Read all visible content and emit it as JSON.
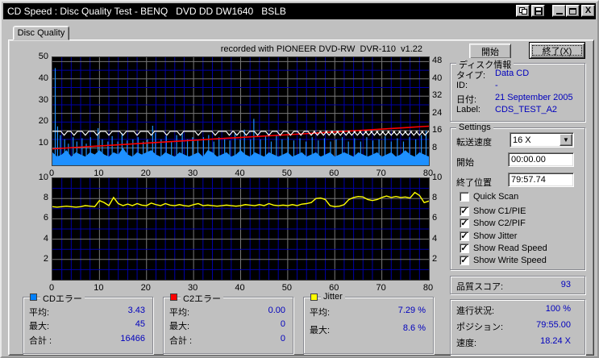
{
  "window": {
    "title": "CD Speed : Disc Quality Test - BENQ   DVD DD DW1640   BSLB",
    "titlebar_buttons": [
      "copy",
      "save",
      "minimize",
      "maximize",
      "close"
    ],
    "close_glyph": "X"
  },
  "tab": {
    "label": "Disc Quality"
  },
  "chart_header": "recorded with PIONEER DVD-RW  DVR-110  v1.22",
  "sidebar": {
    "start_button": "開始",
    "exit_button": "終了(X)",
    "disc_info": {
      "title": "ディスク情報",
      "rows": [
        {
          "label": "タイプ:",
          "value": "Data CD"
        },
        {
          "label": "ID:",
          "value": "-"
        },
        {
          "label": "日付:",
          "value": "21 September 2005"
        },
        {
          "label": "Label:",
          "value": "CDS_TEST_A2"
        }
      ]
    },
    "settings": {
      "title": "Settings",
      "speed_label": "転送速度",
      "speed_value": "16 X",
      "start_label": "開始",
      "start_value": "00:00.00",
      "end_label": "終了位置",
      "end_value": "79:57.74",
      "checkboxes": [
        {
          "label": "Quick Scan",
          "checked": false
        },
        {
          "label": "Show C1/PIE",
          "checked": true
        },
        {
          "label": "Show C2/PIF",
          "checked": true
        },
        {
          "label": "Show Jitter",
          "checked": true
        },
        {
          "label": "Show Read Speed",
          "checked": true
        },
        {
          "label": "Show Write Speed",
          "checked": true
        }
      ]
    },
    "score": {
      "label": "品質スコア:",
      "value": "93"
    },
    "progress": {
      "rows": [
        {
          "label": "進行状況:",
          "value": "100 %"
        },
        {
          "label": "ポジション:",
          "value": "79:55.00"
        },
        {
          "label": "速度:",
          "value": "18.24 X"
        }
      ]
    }
  },
  "stats": [
    {
      "title": "CDエラー",
      "color": "#0080ff",
      "rows": [
        {
          "label": "平均:",
          "value": "3.43"
        },
        {
          "label": "最大:",
          "value": "45"
        },
        {
          "label": "合計 :",
          "value": "16466"
        }
      ]
    },
    {
      "title": "C2エラー",
      "color": "#ff0000",
      "rows": [
        {
          "label": "平均:",
          "value": "0.00"
        },
        {
          "label": "最大:",
          "value": "0"
        },
        {
          "label": "合計 :",
          "value": "0"
        }
      ]
    },
    {
      "title": "Jitter",
      "color": "#ffff00",
      "rows": [
        {
          "label": "平均:",
          "value": "7.29 %"
        },
        {
          "label": "最大:",
          "value": "8.6 %"
        }
      ]
    }
  ],
  "chart_data": [
    {
      "type": "area",
      "name": "c1-errors-and-speed",
      "x_range": [
        0,
        80
      ],
      "x_ticks": [
        0,
        10,
        20,
        30,
        40,
        50,
        60,
        70,
        80
      ],
      "y_left": {
        "range": [
          0,
          50
        ],
        "ticks": [
          10,
          20,
          30,
          40,
          50
        ]
      },
      "y_right": {
        "range": [
          0,
          50
        ],
        "ticks": [
          8,
          16,
          24,
          32,
          40,
          48
        ]
      },
      "grid": {
        "x_minor": 2,
        "x_major": 10,
        "y_minor": 4,
        "y_major": 8,
        "minor_color": "#0000a8",
        "major_color": "#787878"
      },
      "series": [
        {
          "name": "C1/PIE errors",
          "type": "area",
          "color": "#1e90ff",
          "base_values": [
            6,
            4,
            5,
            7,
            4,
            6,
            5,
            4,
            6,
            5,
            7,
            5,
            4,
            6,
            5,
            8,
            5,
            4,
            6,
            5,
            6,
            7,
            5,
            4,
            6,
            5,
            4,
            6,
            5,
            4,
            5,
            6,
            4,
            7,
            6,
            4,
            5,
            6,
            4,
            5,
            7,
            5,
            4,
            6,
            5,
            4,
            6,
            5,
            4,
            5,
            6,
            4,
            5,
            6,
            4,
            5,
            6,
            4,
            5,
            6,
            4,
            5,
            6,
            5,
            4,
            6,
            5,
            4,
            5,
            6,
            4,
            5,
            6,
            4,
            5,
            7,
            5,
            4,
            6,
            5,
            4
          ],
          "spikes": [
            [
              0.6,
              45
            ],
            [
              1.1,
              18
            ],
            [
              1.7,
              14
            ],
            [
              2.6,
              12
            ],
            [
              3.4,
              10
            ],
            [
              4.4,
              13
            ],
            [
              5.2,
              11
            ],
            [
              6.3,
              12.5
            ],
            [
              7.2,
              10
            ],
            [
              8.1,
              13
            ],
            [
              9.7,
              17.2
            ],
            [
              10.6,
              12
            ],
            [
              11.8,
              11
            ],
            [
              12.7,
              13.5
            ],
            [
              13.9,
              11
            ],
            [
              14.8,
              15
            ],
            [
              15.9,
              11.5
            ],
            [
              17.1,
              12
            ],
            [
              18.2,
              13
            ],
            [
              19.3,
              11
            ],
            [
              20.2,
              12
            ],
            [
              21.3,
              18.3
            ],
            [
              21.9,
              15
            ],
            [
              23.1,
              12
            ],
            [
              24.2,
              13.5
            ],
            [
              25.3,
              11
            ],
            [
              26.4,
              14
            ],
            [
              27.6,
              15
            ],
            [
              28.7,
              12
            ],
            [
              29.8,
              13
            ],
            [
              30.9,
              11.5
            ],
            [
              32.1,
              13
            ],
            [
              33.2,
              14
            ],
            [
              34.3,
              11
            ],
            [
              35.4,
              13
            ],
            [
              36.6,
              12
            ],
            [
              37.7,
              11.5
            ],
            [
              38.8,
              15
            ],
            [
              39.9,
              12
            ],
            [
              40.8,
              16.5
            ],
            [
              42.1,
              12
            ],
            [
              42.8,
              21.5
            ],
            [
              44.2,
              12
            ],
            [
              45.3,
              13.8
            ],
            [
              46.5,
              11
            ],
            [
              47.6,
              14
            ],
            [
              48.8,
              12
            ],
            [
              50.1,
              13
            ],
            [
              51.3,
              11.5
            ],
            [
              52.6,
              12.5
            ],
            [
              53.9,
              11
            ],
            [
              55.2,
              13
            ],
            [
              56.5,
              11.5
            ],
            [
              57.8,
              12.5
            ],
            [
              59.1,
              11
            ],
            [
              60.3,
              12
            ],
            [
              61.6,
              13
            ],
            [
              62.9,
              11
            ],
            [
              64.2,
              12.5
            ],
            [
              65.5,
              11
            ],
            [
              66.8,
              13
            ],
            [
              68.1,
              11.5
            ],
            [
              69.4,
              12
            ],
            [
              70.7,
              13.5
            ],
            [
              72.0,
              11
            ],
            [
              73.3,
              12.5
            ],
            [
              74.6,
              11
            ],
            [
              75.9,
              13
            ],
            [
              77.2,
              12
            ],
            [
              78.4,
              14
            ],
            [
              79.4,
              16
            ]
          ]
        },
        {
          "name": "Read speed",
          "type": "line",
          "color": "#ff0000",
          "points": [
            [
              0,
              7.6
            ],
            [
              20,
              10.3
            ],
            [
              40,
              12.9
            ],
            [
              60,
              15.4
            ],
            [
              80,
              18.1
            ]
          ]
        },
        {
          "name": "Write speed",
          "type": "dipline",
          "color": "#ffffff",
          "base": 15.7,
          "dip_value": 13.9,
          "dip_halfwidth": 0.7,
          "dips": [
            2.5,
            4.6,
            7.0,
            9.5,
            12.0,
            15.0,
            18.0,
            21.0,
            24.3,
            27.2,
            31.0,
            34.6,
            37.6,
            39.2,
            41.2,
            43.6,
            46.0,
            48.4,
            50.6,
            52.8,
            55.0,
            56.3,
            57.6,
            58.8,
            60.0,
            61.2,
            62.4,
            63.6,
            64.8,
            66.0,
            67.2,
            68.4,
            69.6,
            70.8,
            72.0,
            73.2,
            74.4,
            75.6,
            76.8,
            78.0,
            79.2
          ]
        }
      ]
    },
    {
      "type": "line",
      "name": "jitter",
      "x_range": [
        0,
        80
      ],
      "x_ticks": [
        0,
        10,
        20,
        30,
        40,
        50,
        60,
        70,
        80
      ],
      "y_left": {
        "range": [
          0,
          10
        ],
        "ticks": [
          2,
          4,
          6,
          8,
          10
        ]
      },
      "y_right": {
        "range": [
          0,
          10
        ],
        "ticks": [
          2,
          4,
          6,
          8,
          10
        ]
      },
      "grid": {
        "x_minor": 2,
        "x_major": 10,
        "y_minor": 1,
        "y_major": 2,
        "minor_color": "#0000a8",
        "major_color": "#787878"
      },
      "series": [
        {
          "name": "Jitter",
          "type": "values",
          "color": "#ffff00",
          "values": [
            7.2,
            7.15,
            7.2,
            7.25,
            7.2,
            7.15,
            7.2,
            7.3,
            7.25,
            7.2,
            7.8,
            7.6,
            7.3,
            8.1,
            7.5,
            7.3,
            7.45,
            7.3,
            7.5,
            7.35,
            7.3,
            7.55,
            7.4,
            7.3,
            7.5,
            7.35,
            7.3,
            7.4,
            7.3,
            7.25,
            7.4,
            7.5,
            7.3,
            7.35,
            7.3,
            7.25,
            7.3,
            7.35,
            7.3,
            7.25,
            7.3,
            7.4,
            7.35,
            7.3,
            7.4,
            7.3,
            7.5,
            7.35,
            7.3,
            7.35,
            7.3,
            7.4,
            7.3,
            7.45,
            7.5,
            7.6,
            8.0,
            8.05,
            7.9,
            7.3,
            7.2,
            7.25,
            7.4,
            7.9,
            8.1,
            8.2,
            8.15,
            7.9,
            7.8,
            7.9,
            8.1,
            8.25,
            8.1,
            8.2,
            8.1,
            8.15,
            8.05,
            8.6,
            8.3,
            7.6,
            7.75
          ]
        }
      ]
    }
  ]
}
